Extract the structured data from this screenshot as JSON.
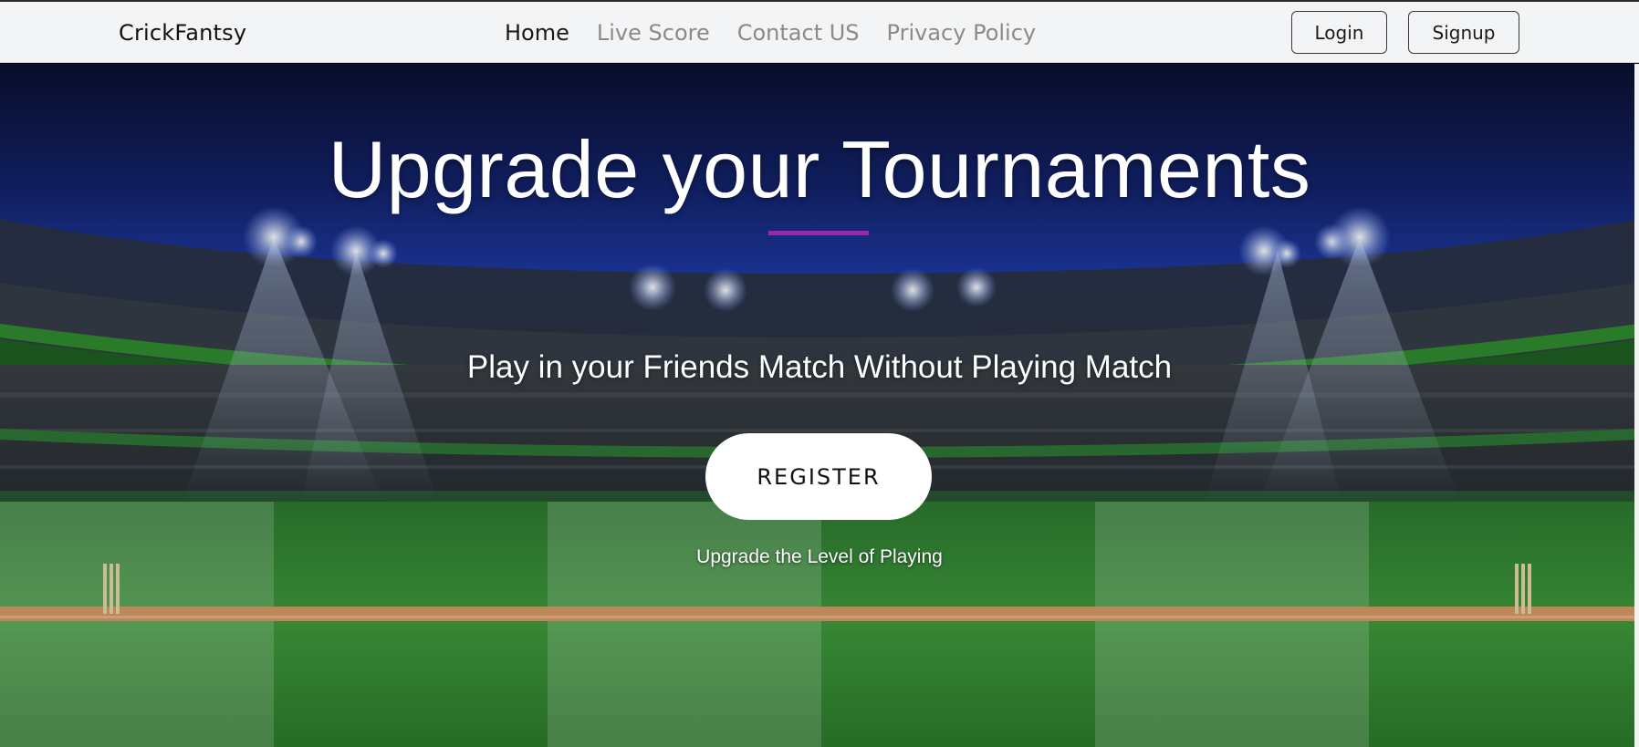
{
  "app": {
    "brand": "CrickFantsy"
  },
  "nav": {
    "links": [
      {
        "label": "Home",
        "active": true
      },
      {
        "label": "Live Score",
        "active": false
      },
      {
        "label": "Contact US",
        "active": false
      },
      {
        "label": "Privacy Policy",
        "active": false
      }
    ],
    "login_label": "Login",
    "signup_label": "Signup"
  },
  "hero": {
    "title": "Upgrade your Tournaments",
    "subtitle": "Play in your Friends Match Without Playing Match",
    "register_label": "REGISTER",
    "tagline": "Upgrade the Level of Playing",
    "background": "cricket-stadium-night-image"
  },
  "colors": {
    "navbar_bg": "#f3f4f6",
    "accent_underline": "#9b27b0",
    "sky": "#1a2f8a",
    "pitch": "#d99a66",
    "grass": "#3c8f3a"
  }
}
